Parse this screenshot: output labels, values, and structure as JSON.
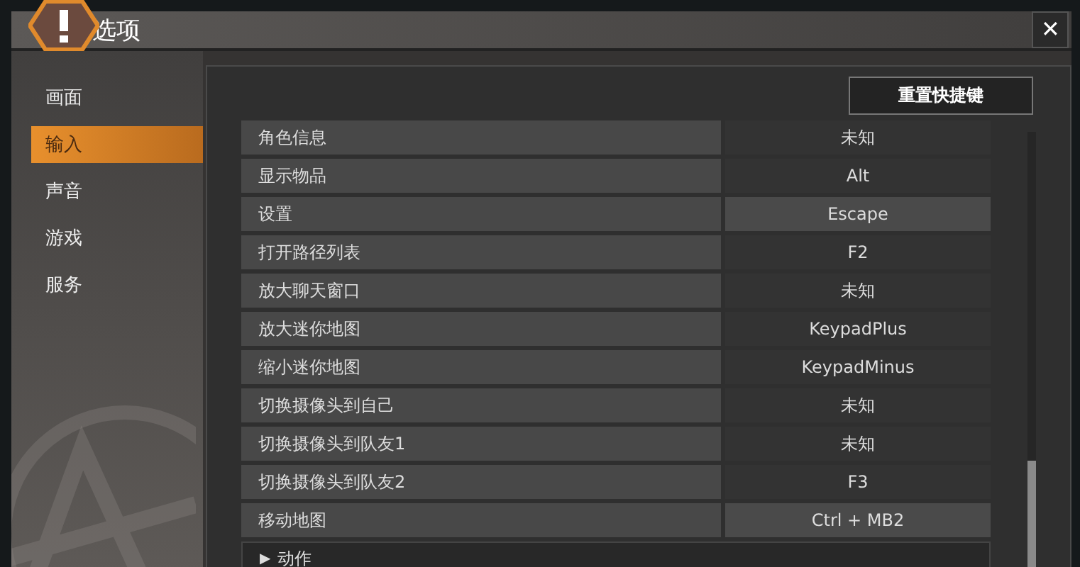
{
  "window": {
    "title": "选项",
    "close": "✕"
  },
  "sidebar": {
    "items": [
      {
        "label": "画面",
        "selected": false
      },
      {
        "label": "输入",
        "selected": true
      },
      {
        "label": "声音",
        "selected": false
      },
      {
        "label": "游戏",
        "selected": false
      },
      {
        "label": "服务",
        "selected": false
      }
    ]
  },
  "reset_button": "重置快捷键",
  "bindings": [
    {
      "action": "角色信息",
      "key": "未知",
      "highlighted": false
    },
    {
      "action": "显示物品",
      "key": "Alt",
      "highlighted": false
    },
    {
      "action": "设置",
      "key": "Escape",
      "highlighted": true
    },
    {
      "action": "打开路径列表",
      "key": "F2",
      "highlighted": false
    },
    {
      "action": "放大聊天窗口",
      "key": "未知",
      "highlighted": false
    },
    {
      "action": "放大迷你地图",
      "key": "KeypadPlus",
      "highlighted": false
    },
    {
      "action": "缩小迷你地图",
      "key": "KeypadMinus",
      "highlighted": false
    },
    {
      "action": "切换摄像头到自己",
      "key": "未知",
      "highlighted": false
    },
    {
      "action": "切换摄像头到队友1",
      "key": "未知",
      "highlighted": false
    },
    {
      "action": "切换摄像头到队友2",
      "key": "F3",
      "highlighted": false
    },
    {
      "action": "移动地图",
      "key": "Ctrl + MB2",
      "highlighted": true
    }
  ],
  "section": {
    "arrow": "▶",
    "label": "动作",
    "expanded": false
  }
}
